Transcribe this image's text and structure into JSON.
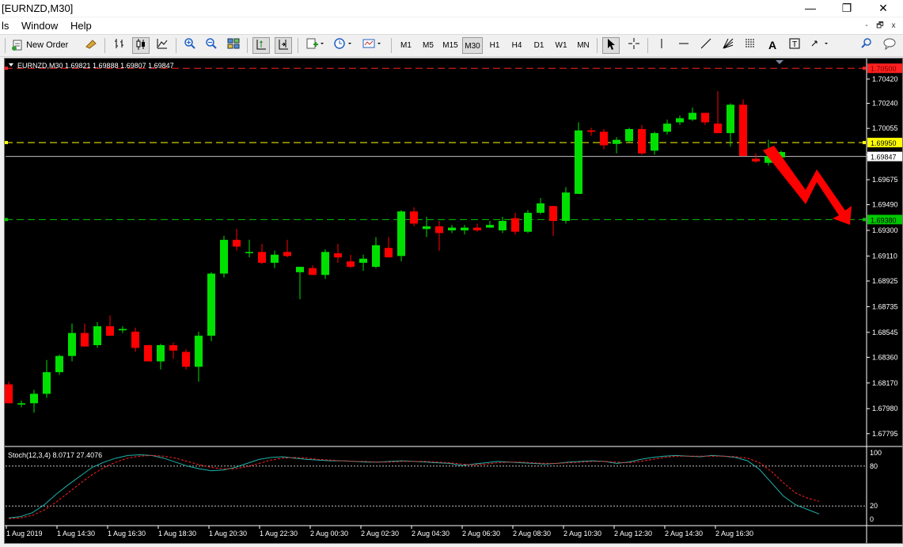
{
  "window": {
    "title": "[EURNZD,M30]",
    "minimize_glyph": "—",
    "restore_glyph": "❐",
    "close_glyph": "✕"
  },
  "menu": {
    "items": [
      {
        "label": "ls"
      },
      {
        "label": "Window"
      },
      {
        "label": "Help"
      }
    ],
    "mdi_min": "-",
    "mdi_restore": "🗗",
    "mdi_close": "x"
  },
  "toolbar": {
    "new_order_label": "New Order",
    "timeframes": [
      "M1",
      "M5",
      "M15",
      "M30",
      "H1",
      "H4",
      "D1",
      "W1",
      "MN"
    ],
    "active_timeframe": "M30",
    "icons": [
      "bar-chart-icon",
      "candle-chart-icon",
      "line-chart-icon",
      "zoom-in-icon",
      "zoom-out-icon",
      "tile-icon",
      "autoscroll-icon",
      "chart-shift-icon",
      "indicators-icon",
      "periods-icon",
      "templates-icon",
      "cursor-icon",
      "crosshair-icon",
      "vertical-line-icon",
      "horizontal-line-icon",
      "trendline-icon",
      "fibonacci-fan-icon",
      "fibonacci-icon",
      "text-icon",
      "label-icon",
      "arrows-icon",
      "search-icon",
      "chat-icon"
    ]
  },
  "colors": {
    "bull": "#00e000",
    "bear": "#ff0000",
    "resistance": "#ff2020",
    "yellow_level": "#ffff00",
    "support": "#00c800",
    "current": "#c0c0c0",
    "stoch_main": "#20b2aa",
    "stoch_signal": "#ff2020",
    "arrow": "#ff0000"
  },
  "chart_data": {
    "type": "candlestick",
    "symbol_header": "EURNZD,M30",
    "ohlc_header": "1.69821 1.69888 1.69807 1.69847",
    "candles": [
      [
        1.6816,
        1.6818,
        1.6802,
        1.6802
      ],
      [
        1.6801,
        1.6804,
        1.6799,
        1.6802
      ],
      [
        1.6802,
        1.6812,
        1.6795,
        1.6809
      ],
      [
        1.6809,
        1.6834,
        1.6806,
        1.6825
      ],
      [
        1.6825,
        1.6838,
        1.6823,
        1.6837
      ],
      [
        1.6837,
        1.6861,
        1.6833,
        1.6854
      ],
      [
        1.6854,
        1.6861,
        1.6844,
        1.6844
      ],
      [
        1.6845,
        1.6862,
        1.6843,
        1.6859
      ],
      [
        1.6859,
        1.6867,
        1.6852,
        1.6852
      ],
      [
        1.6856,
        1.6859,
        1.6854,
        1.6857
      ],
      [
        1.6855,
        1.6858,
        1.684,
        1.6843
      ],
      [
        1.6845,
        1.6845,
        1.6833,
        1.6833
      ],
      [
        1.6833,
        1.6846,
        1.6827,
        1.6845
      ],
      [
        1.6845,
        1.6847,
        1.6835,
        1.6841
      ],
      [
        1.684,
        1.6842,
        1.6827,
        1.6829
      ],
      [
        1.6829,
        1.6855,
        1.6818,
        1.6852
      ],
      [
        1.6852,
        1.6899,
        1.6848,
        1.6898
      ],
      [
        1.6898,
        1.6926,
        1.6895,
        1.6923
      ],
      [
        1.6923,
        1.6931,
        1.6915,
        1.6918
      ],
      [
        1.6914,
        1.6923,
        1.691,
        1.6914
      ],
      [
        1.6914,
        1.692,
        1.6905,
        1.6906
      ],
      [
        1.6906,
        1.6915,
        1.6902,
        1.6912
      ],
      [
        1.6914,
        1.6923,
        1.691,
        1.6911
      ],
      [
        1.6899,
        1.6903,
        1.6879,
        1.6903
      ],
      [
        1.6902,
        1.6904,
        1.6897,
        1.6897
      ],
      [
        1.6897,
        1.6916,
        1.6894,
        1.6914
      ],
      [
        1.6913,
        1.692,
        1.6906,
        1.691
      ],
      [
        1.6907,
        1.6912,
        1.6902,
        1.6903
      ],
      [
        1.6906,
        1.6912,
        1.69,
        1.6909
      ],
      [
        1.6903,
        1.6925,
        1.6902,
        1.6919
      ],
      [
        1.6917,
        1.6925,
        1.691,
        1.691
      ],
      [
        1.6911,
        1.6945,
        1.6907,
        1.6944
      ],
      [
        1.6944,
        1.6947,
        1.6933,
        1.6935
      ],
      [
        1.6931,
        1.694,
        1.6925,
        1.6933
      ],
      [
        1.6933,
        1.6937,
        1.6915,
        1.6928
      ],
      [
        1.693,
        1.6934,
        1.6928,
        1.6932
      ],
      [
        1.693,
        1.6934,
        1.6927,
        1.6932
      ],
      [
        1.6932,
        1.6935,
        1.6929,
        1.693
      ],
      [
        1.6932,
        1.6937,
        1.6932,
        1.6934
      ],
      [
        1.693,
        1.694,
        1.6928,
        1.6937
      ],
      [
        1.6939,
        1.6943,
        1.6927,
        1.6929
      ],
      [
        1.6929,
        1.6945,
        1.6928,
        1.6943
      ],
      [
        1.6943,
        1.6954,
        1.6942,
        1.695
      ],
      [
        1.6948,
        1.6948,
        1.6926,
        1.6937
      ],
      [
        1.6937,
        1.6962,
        1.6935,
        1.6958
      ],
      [
        1.6957,
        1.701,
        1.6957,
        1.7004
      ],
      [
        1.7004,
        1.7006,
        1.7,
        1.7003
      ],
      [
        1.7003,
        1.7005,
        1.699,
        1.6993
      ],
      [
        1.6994,
        1.6999,
        1.6987,
        1.6997
      ],
      [
        1.6996,
        1.7006,
        1.6995,
        1.7005
      ],
      [
        1.7005,
        1.7008,
        1.6986,
        1.6987
      ],
      [
        1.6989,
        1.7003,
        1.6986,
        1.7002
      ],
      [
        1.7003,
        1.7012,
        1.7001,
        1.7009
      ],
      [
        1.701,
        1.7015,
        1.7008,
        1.7013
      ],
      [
        1.7012,
        1.7021,
        1.7011,
        1.7017
      ],
      [
        1.7017,
        1.7017,
        1.7008,
        1.701
      ],
      [
        1.7009,
        1.7033,
        1.7002,
        1.7002
      ],
      [
        1.7002,
        1.7024,
        1.6992,
        1.7023
      ],
      [
        1.7023,
        1.7027,
        1.6985,
        1.6985
      ],
      [
        1.6983,
        1.6987,
        1.698,
        1.6981
      ],
      [
        1.698,
        1.6997,
        1.6978,
        1.6985
      ],
      [
        1.6984,
        1.6989,
        1.6982,
        1.6988
      ]
    ],
    "price_ticks": [
      "1.70240",
      "1.70055",
      "1.69860",
      "1.69675",
      "1.69490",
      "1.69300",
      "1.69110",
      "1.68925",
      "1.68735",
      "1.68545",
      "1.68360",
      "1.68170",
      "1.67980",
      "1.67795",
      "1.70420"
    ],
    "levels": [
      {
        "price": 1.705,
        "label": "1.70500",
        "style": "resistance"
      },
      {
        "price": 1.6995,
        "label": "1.69950",
        "style": "yellow_level"
      },
      {
        "price": 1.6938,
        "label": "1.69380",
        "style": "support"
      },
      {
        "price": 1.69847,
        "label": "1.69847",
        "style": "current"
      }
    ],
    "ylim": [
      1.677,
      1.7056
    ],
    "time_labels": [
      "1 Aug 2019",
      "1 Aug 14:30",
      "1 Aug 16:30",
      "1 Aug 18:30",
      "1 Aug 20:30",
      "1 Aug 22:30",
      "2 Aug 00:30",
      "2 Aug 02:30",
      "2 Aug 04:30",
      "2 Aug 06:30",
      "2 Aug 08:30",
      "2 Aug 10:30",
      "2 Aug 12:30",
      "2 Aug 14:30",
      "2 Aug 16:30"
    ],
    "stoch": {
      "header": "Stoch(12,3,4) 8.0717 27.4076",
      "ticks": [
        "100",
        "80",
        "20",
        "0"
      ],
      "levels": [
        80,
        20
      ],
      "main": [
        2,
        4,
        10,
        22,
        38,
        52,
        65,
        78,
        86,
        92,
        96,
        97,
        96,
        92,
        86,
        80,
        76,
        73,
        74,
        78,
        84,
        90,
        93,
        94,
        92,
        90,
        89,
        88,
        88,
        87,
        86,
        86,
        87,
        88,
        87,
        86,
        85,
        84,
        81,
        83,
        85,
        87,
        86,
        85,
        84,
        83,
        84,
        86,
        87,
        88,
        87,
        84,
        86,
        90,
        93,
        95,
        96,
        95,
        94,
        96,
        95,
        93,
        88,
        75,
        55,
        35,
        22,
        15,
        8
      ],
      "signal": [
        1,
        2,
        6,
        14,
        26,
        40,
        54,
        67,
        78,
        86,
        92,
        95,
        96,
        95,
        92,
        87,
        82,
        78,
        76,
        76,
        79,
        84,
        89,
        92,
        93,
        92,
        90,
        89,
        88,
        87,
        87,
        86,
        86,
        87,
        87,
        87,
        86,
        85,
        83,
        82,
        83,
        85,
        86,
        86,
        85,
        84,
        84,
        85,
        86,
        87,
        87,
        86,
        85,
        87,
        90,
        93,
        95,
        95,
        95,
        95,
        95,
        94,
        92,
        85,
        72,
        55,
        40,
        32,
        27
      ]
    }
  }
}
